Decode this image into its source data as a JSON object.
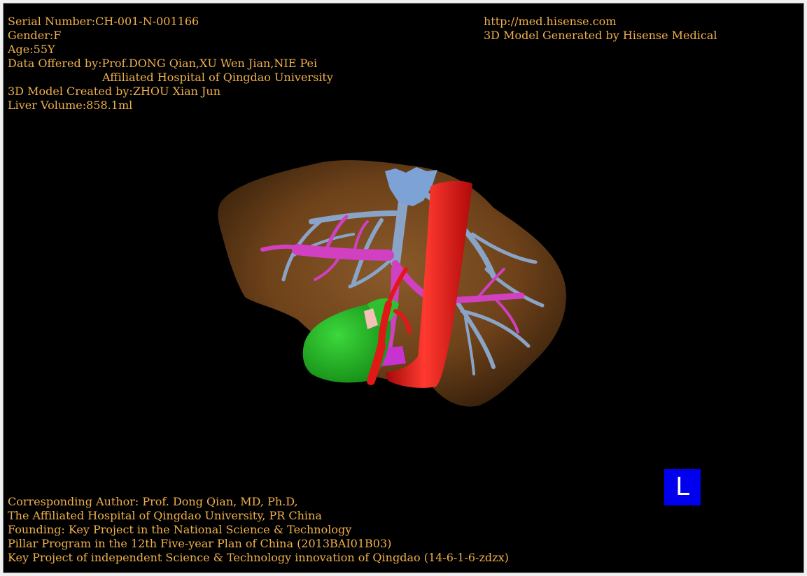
{
  "header_left": {
    "serial": "Serial Number:CH-001-N-001166",
    "gender": "Gender:F",
    "age": "Age:55Y",
    "data_offered": "Data Offered by:Prof.DONG Qian,XU Wen Jian,NIE Pei",
    "hospital": "Affiliated Hospital of Qingdao University",
    "model_created": "3D Model Created by:ZHOU Xian Jun",
    "liver_volume": "Liver Volume:858.1ml"
  },
  "header_right": {
    "url": "http://med.hisense.com",
    "generated_by": "3D Model Generated by Hisense Medical"
  },
  "footer": {
    "line1": "Corresponding Author: Prof. Dong Qian, MD, Ph.D,",
    "line2": "The Affiliated Hospital of Qingdao University, PR China",
    "line3": "Founding: Key Project in the National Science & Technology",
    "line4": "Pillar Program in the 12th Five-year Plan of China (2013BAI01B03)",
    "line5": "Key Project of independent Science & Technology innovation of Qingdao (14-6-1-6-zdzx)"
  },
  "orientation_marker": "L",
  "colors": {
    "text": "#f0b04a",
    "background": "#000000",
    "liver": "#7a4a1e",
    "hepatic_vein": "#8aa4c8",
    "portal_vein": "#d040c0",
    "artery_ivc": "#e01818",
    "gallbladder": "#20b020",
    "marker_bg": "#0000ee"
  }
}
